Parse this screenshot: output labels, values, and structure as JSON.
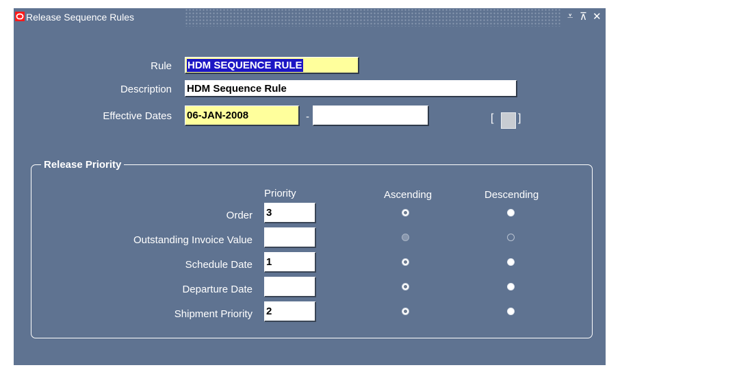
{
  "window": {
    "title": "Release Sequence Rules",
    "accent": "#5f7391"
  },
  "icons": {
    "logo": "oracle-logo-icon",
    "minimize": "minimize-icon",
    "maximize": "maximize-icon",
    "close": "close-icon"
  },
  "form": {
    "rule_label": "Rule",
    "rule_value": "HDM SEQUENCE RULE",
    "description_label": "Description",
    "description_value": "HDM Sequence Rule",
    "effective_dates_label": "Effective Dates",
    "date_from": "06-JAN-2008",
    "date_separator": "-",
    "date_to": "",
    "bracket_open": "[",
    "bracket_close": "]"
  },
  "release_priority": {
    "title": "Release Priority",
    "headers": {
      "priority": "Priority",
      "ascending": "Ascending",
      "descending": "Descending"
    },
    "rows": [
      {
        "label": "Order",
        "priority": "3",
        "ascending": "selected",
        "descending": "unselected"
      },
      {
        "label": "Outstanding Invoice Value",
        "priority": "",
        "ascending": "disabled-selected",
        "descending": "disabled"
      },
      {
        "label": "Schedule Date",
        "priority": "1",
        "ascending": "selected",
        "descending": "unselected"
      },
      {
        "label": "Departure Date",
        "priority": "",
        "ascending": "selected",
        "descending": "unselected"
      },
      {
        "label": "Shipment Priority",
        "priority": "2",
        "ascending": "selected",
        "descending": "unselected"
      }
    ]
  }
}
